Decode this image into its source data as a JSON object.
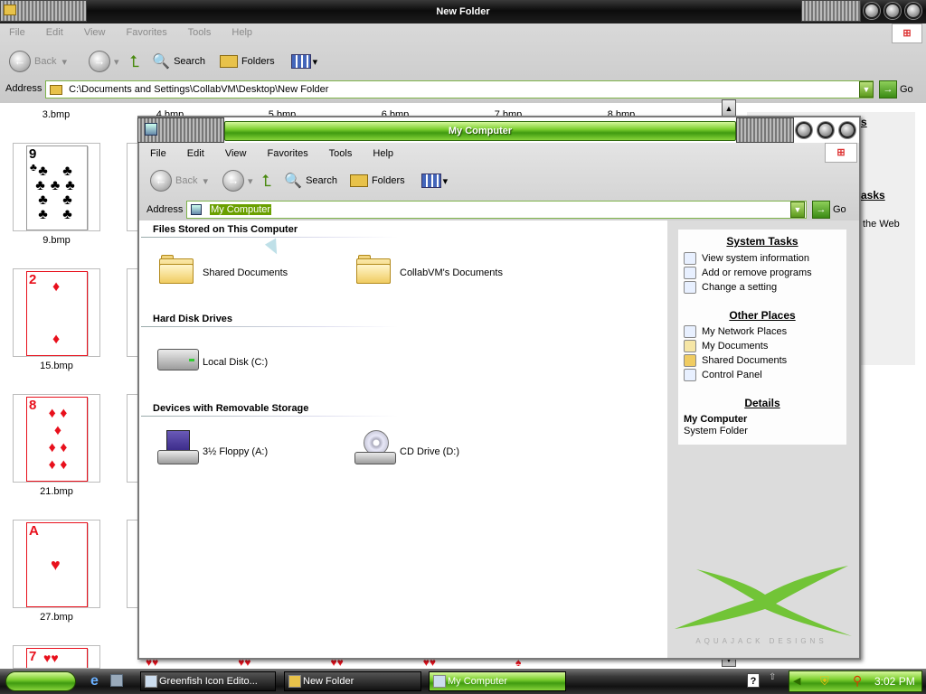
{
  "back_window": {
    "title": "New Folder",
    "menu": [
      "File",
      "Edit",
      "View",
      "Favorites",
      "Tools",
      "Help"
    ],
    "toolbar": {
      "back": "Back",
      "search": "Search",
      "folders": "Folders"
    },
    "address_label": "Address",
    "address_value": "C:\\Documents and Settings\\CollabVM\\Desktop\\New Folder",
    "go": "Go",
    "top_row_labels": [
      "3.bmp",
      "4.bmp",
      "5.bmp",
      "6.bmp",
      "7.bmp",
      "8.bmp"
    ],
    "left_column": [
      {
        "label": "9.bmp",
        "rank": "9",
        "suit": "♣",
        "color": "black"
      },
      {
        "label": "15.bmp",
        "rank": "2",
        "suit": "♦",
        "color": "red"
      },
      {
        "label": "21.bmp",
        "rank": "8",
        "suit": "♦",
        "color": "red"
      },
      {
        "label": "27.bmp",
        "rank": "A",
        "suit": "♥",
        "color": "red"
      },
      {
        "label": "",
        "rank": "7",
        "suit": "♥",
        "color": "red"
      }
    ],
    "behind_panel_texts": [
      "s",
      "asks",
      "the Web"
    ]
  },
  "front_window": {
    "title": "My Computer",
    "menu": [
      "File",
      "Edit",
      "View",
      "Favorites",
      "Tools",
      "Help"
    ],
    "toolbar": {
      "back": "Back",
      "search": "Search",
      "folders": "Folders"
    },
    "address_label": "Address",
    "address_value": "My Computer",
    "go": "Go",
    "sections": [
      {
        "heading": "Files Stored on This Computer",
        "items": [
          "Shared Documents",
          "CollabVM's Documents"
        ]
      },
      {
        "heading": "Hard Disk Drives",
        "items": [
          "Local Disk (C:)"
        ]
      },
      {
        "heading": "Devices with Removable Storage",
        "items": [
          "3½ Floppy (A:)",
          "CD Drive (D:)"
        ]
      }
    ],
    "system_tasks": {
      "title": "System Tasks",
      "items": [
        "View system information",
        "Add or remove programs",
        "Change a setting"
      ]
    },
    "other_places": {
      "title": "Other Places",
      "items": [
        "My Network Places",
        "My Documents",
        "Shared Documents",
        "Control Panel"
      ]
    },
    "details": {
      "title": "Details",
      "name": "My Computer",
      "type": "System Folder"
    },
    "watermark": "AQUAJACK DESIGNS"
  },
  "taskbar": {
    "buttons": [
      {
        "label": "Greenfish Icon Edito...",
        "active": false
      },
      {
        "label": "New Folder",
        "active": false
      },
      {
        "label": "My Computer",
        "active": true
      }
    ],
    "clock": "3:02 PM",
    "help_icon": "?"
  }
}
